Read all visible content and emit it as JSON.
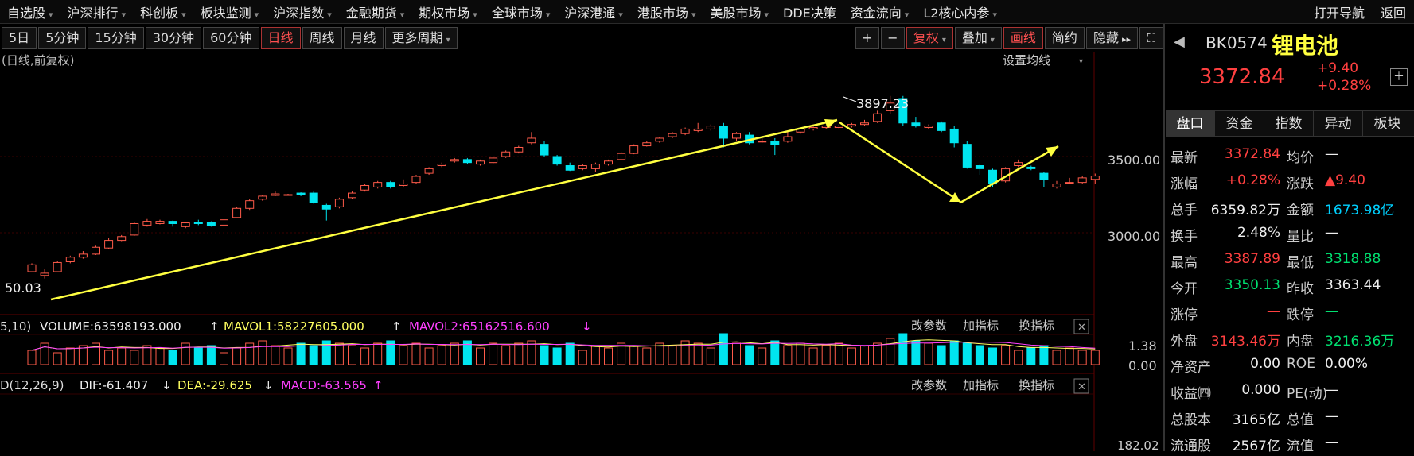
{
  "menu": {
    "items": [
      {
        "label": "自选股",
        "dd": true
      },
      {
        "label": "沪深排行",
        "dd": true
      },
      {
        "label": "科创板",
        "dd": true
      },
      {
        "label": "板块监测",
        "dd": true
      },
      {
        "label": "沪深指数",
        "dd": true
      },
      {
        "label": "金融期货",
        "dd": true
      },
      {
        "label": "期权市场",
        "dd": true
      },
      {
        "label": "全球市场",
        "dd": true
      },
      {
        "label": "沪深港通",
        "dd": true
      },
      {
        "label": "港股市场",
        "dd": true
      },
      {
        "label": "美股市场",
        "dd": true
      },
      {
        "label": "DDE决策",
        "dd": false
      },
      {
        "label": "资金流向",
        "dd": true
      },
      {
        "label": "L2核心内参",
        "dd": true
      }
    ],
    "open_nav": "打开导航",
    "back": "返回"
  },
  "toolbar": {
    "periods": [
      "5日",
      "5分钟",
      "15分钟",
      "30分钟",
      "60分钟",
      "日线",
      "周线",
      "月线",
      "更多周期"
    ],
    "active_period": "日线",
    "plus": "+",
    "minus": "−",
    "restore": "复权",
    "overlay": "叠加",
    "draw": "画线",
    "simple": "简约",
    "hide": "隐藏"
  },
  "chart": {
    "title": "(日线,前复权)",
    "set_ma": "设置均线",
    "high_label": "3897.23",
    "low_label": "50.03",
    "price_ticks": [
      "3500.00",
      "3000.00"
    ],
    "volume_legend": {
      "prefix": "5,10)",
      "volume": "VOLUME:63598193.000",
      "mavol1": "MAVOL1:58227605.000",
      "mavol2": "MAVOL2:65162516.600"
    },
    "volume_ticks": [
      "1.38",
      "0.00"
    ],
    "macd_legend": {
      "prefix": "D(12,26,9)",
      "dif": "DIF:-61.407",
      "dea": "DEA:-29.625",
      "macd": "MACD:-63.565"
    },
    "macd_tick": "182.02",
    "panel_buttons": [
      "改参数",
      "加指标",
      "换指标"
    ],
    "colors": {
      "up": "#ff5b4a",
      "down": "#00e5ef",
      "arrow": "#ffff40",
      "mavol2": "#ff40ff",
      "mavol1": "#ffff60"
    }
  },
  "quote": {
    "code": "BK0574",
    "name": "锂电池",
    "price": "3372.84",
    "change": "+9.40",
    "change_pct": "+0.28%",
    "tabs": [
      "盘口",
      "资金",
      "指数",
      "异动",
      "板块"
    ],
    "rows": [
      {
        "l1": "最新",
        "v1": "3372.84",
        "c1": "red",
        "l2": "均价",
        "v2": "—",
        "c2": "white"
      },
      {
        "l1": "涨幅",
        "v1": "+0.28%",
        "c1": "red",
        "l2": "涨跌",
        "v2": "▲9.40",
        "c2": "red"
      },
      {
        "l1": "总手",
        "v1": "6359.82万",
        "c1": "white",
        "l2": "金额",
        "v2": "1673.98亿",
        "c2": "cyan"
      },
      {
        "l1": "换手",
        "v1": "2.48%",
        "c1": "white",
        "l2": "量比",
        "v2": "—",
        "c2": "white"
      },
      {
        "l1": "最高",
        "v1": "3387.89",
        "c1": "red",
        "l2": "最低",
        "v2": "3318.88",
        "c2": "green"
      },
      {
        "l1": "今开",
        "v1": "3350.13",
        "c1": "green",
        "l2": "昨收",
        "v2": "3363.44",
        "c2": "white"
      },
      {
        "l1": "涨停",
        "v1": "—",
        "c1": "red",
        "l2": "跌停",
        "v2": "—",
        "c2": "green"
      },
      {
        "l1": "外盘",
        "v1": "3143.46万",
        "c1": "red",
        "l2": "内盘",
        "v2": "3216.36万",
        "c2": "green"
      },
      {
        "l1": "净资产",
        "v1": "0.00",
        "c1": "white",
        "l2": "ROE",
        "v2": "0.00%",
        "c2": "white"
      },
      {
        "l1": "收益㈣",
        "v1": "0.000",
        "c1": "white",
        "l2": "PE(动)",
        "v2": "—",
        "c2": "white"
      },
      {
        "l1": "总股本",
        "v1": "3165亿",
        "c1": "white",
        "l2": "总值",
        "v2": "—",
        "c2": "white"
      },
      {
        "l1": "流通股",
        "v1": "2567亿",
        "c1": "white",
        "l2": "流值",
        "v2": "—",
        "c2": "white"
      }
    ]
  }
}
